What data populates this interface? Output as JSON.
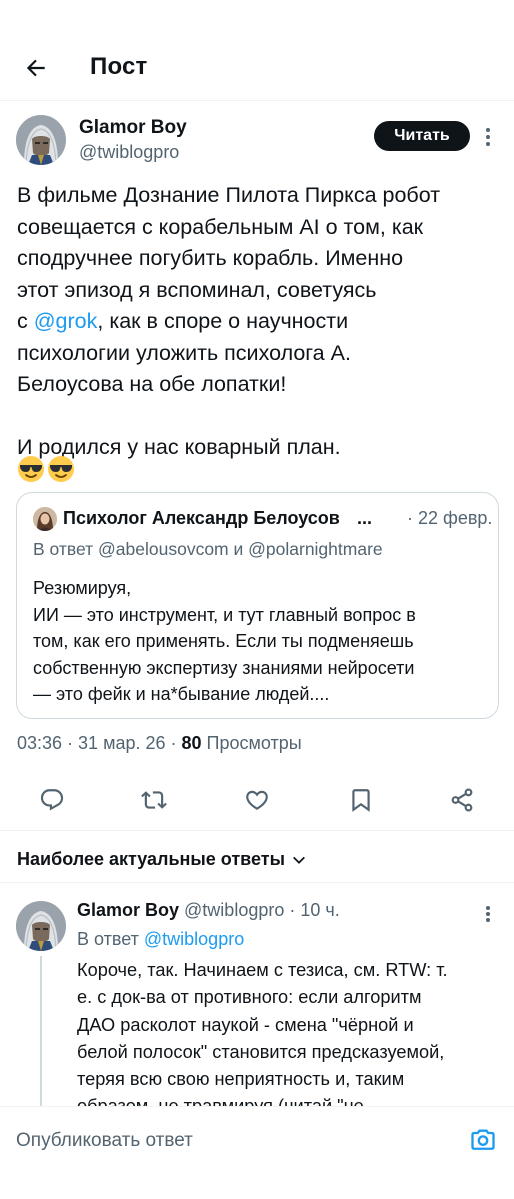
{
  "header": {
    "title": "Пост"
  },
  "post": {
    "author_name": "Glamor Boy",
    "author_handle": "@twiblogpro",
    "read_button": "Читать",
    "text_lines": [
      "В фильме Дознание Пилота Пиркса робот",
      "совещается с корабельным AI о том, как",
      "сподручнее погубить корабль. Именно",
      "этот эпизод я вспоминал, советуясь"
    ],
    "line5_prefix": "с ",
    "line5_mention": "@grok",
    "line5_suffix": ", как в споре о научности",
    "text_lines_after": [
      "психологии уложить психолога А.",
      "Белоусова на обе лопатки!"
    ],
    "final_line": "И родился у нас коварный план.",
    "emojis": [
      "sunglasses-emoji",
      "sunglasses-emoji"
    ]
  },
  "quote": {
    "author_name": "Психолог Александр Белоусов",
    "ellipsis": "...",
    "date": "· 22 февр.",
    "reply_to": "В ответ @abelousovcom и @polarnightmare",
    "text_lines": [
      "Резюмируя,",
      "ИИ — это инструмент, и тут главный вопрос в",
      "том, как его применять. Если ты подменяешь",
      "собственную экспертизу знаниями нейросети",
      "— это фейк и на*бывание людей...."
    ]
  },
  "meta": {
    "time": "03:36 · 31 мар. 26 · ",
    "views_count": "80",
    "views_label": " Просмотры"
  },
  "actions": {
    "icons": [
      "reply-icon",
      "retweet-icon",
      "like-icon",
      "bookmark-icon",
      "share-icon"
    ]
  },
  "sort": {
    "label": "Наиболее актуальные ответы"
  },
  "reply": {
    "author_name": "Glamor Boy",
    "author_handle": " @twiblogpro · 10 ч.",
    "reply_to_prefix": "В ответ ",
    "reply_to_mention": "@twiblogpro",
    "text_lines": [
      "Короче, так. Начинаем с тезиса, см. RTW: т.",
      "е. с док-ва от противного: если алгоритм",
      "ДАО расколот наукой - смена \"чёрной и",
      "белой полосок\" становится предсказуемой,",
      "теряя всю свою неприятность и, таким",
      "образом, не травмируя (читай \"не"
    ]
  },
  "composer": {
    "placeholder": "Опубликовать ответ"
  },
  "colors": {
    "accent": "#1d9bf0",
    "text": "#0f1419",
    "secondary": "#536471",
    "border": "#cfd9de"
  }
}
